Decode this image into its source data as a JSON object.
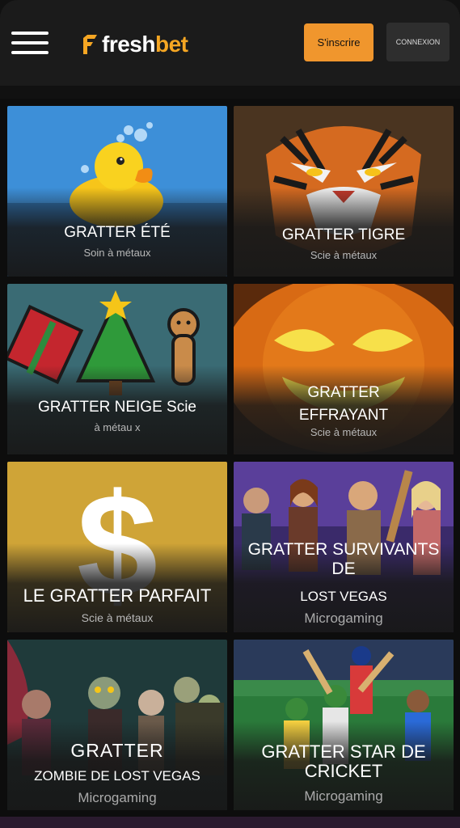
{
  "header": {
    "brand_left": "fresh",
    "brand_right": "bet",
    "signup_label": "S'inscrire",
    "login_label": "CONNEXION"
  },
  "games": [
    {
      "title": "GRATTER ÉTÉ",
      "subtitle": "Soin à métaux",
      "icon": "rubber-duck"
    },
    {
      "title": "GRATTER TIGRE",
      "subtitle": "Scie à métaux",
      "icon": "tiger-face"
    },
    {
      "title": "GRATTER NEIGE Scie",
      "subtitle": "à métau x",
      "icon": "christmas-tree"
    },
    {
      "title_line1": "GRATTER",
      "title_line2": "EFFRAYANT",
      "subtitle": "Scie à métaux",
      "icon": "pumpkin"
    },
    {
      "title": "LE GRATTER PARFAIT",
      "subtitle": "Scie à métaux",
      "icon": "dollar-sign"
    },
    {
      "title_line1": "GRATTER SURVIVANTS DE",
      "title_line2": "LOST VEGAS",
      "subtitle": "Microgaming",
      "icon": "survivors-group"
    },
    {
      "title_line1": "GRATTER",
      "title_line2": "ZOMBIE DE LOST VEGAS",
      "subtitle": "Microgaming",
      "icon": "zombie-group"
    },
    {
      "title": "GRATTER STAR DE CRICKET",
      "subtitle": "Microgaming",
      "icon": "cricket-players"
    }
  ],
  "colors": {
    "accent": "#f0962d",
    "header_bg": "#1b1b1b",
    "page_bg": "#111111"
  }
}
